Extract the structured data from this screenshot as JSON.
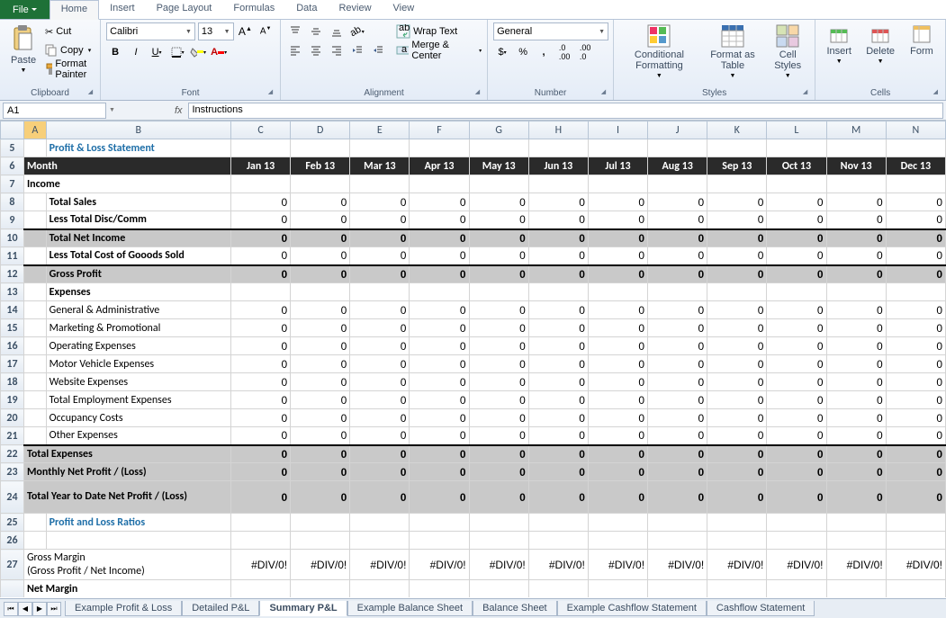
{
  "tabs": {
    "file": "File",
    "list": [
      "Home",
      "Insert",
      "Page Layout",
      "Formulas",
      "Data",
      "Review",
      "View"
    ],
    "active": 0
  },
  "clipboard": {
    "paste": "Paste",
    "cut": "Cut",
    "copy": "Copy",
    "fp": "Format Painter",
    "label": "Clipboard"
  },
  "font": {
    "name": "Calibri",
    "size": "13",
    "label": "Font"
  },
  "alignment": {
    "wrap": "Wrap Text",
    "merge": "Merge & Center",
    "label": "Alignment"
  },
  "number": {
    "format": "General",
    "label": "Number"
  },
  "styles": {
    "cf": "Conditional Formatting",
    "fat": "Format as Table",
    "cs": "Cell Styles",
    "label": "Styles"
  },
  "cells": {
    "ins": "Insert",
    "del": "Delete",
    "fmt": "Form",
    "label": "Cells"
  },
  "fbar": {
    "name": "A1",
    "value": "Instructions"
  },
  "cols": [
    "A",
    "B",
    "C",
    "D",
    "E",
    "F",
    "G",
    "H",
    "I",
    "J",
    "K",
    "L",
    "M",
    "N"
  ],
  "rows": [
    5,
    6,
    7,
    8,
    9,
    10,
    11,
    12,
    13,
    14,
    15,
    16,
    17,
    18,
    19,
    20,
    21,
    22,
    23,
    24,
    25,
    26,
    27
  ],
  "months": [
    "Jan 13",
    "Feb 13",
    "Mar 13",
    "Apr 13",
    "May 13",
    "Jun 13",
    "Jul 13",
    "Aug 13",
    "Sep 13",
    "Oct 13",
    "Nov 13",
    "Dec 13"
  ],
  "labels": {
    "title": "Profit & Loss Statement",
    "month": "Month",
    "income": "Income",
    "totSales": "Total Sales",
    "lessDisc": "Less Total Disc/Comm",
    "totNet": "Total Net Income",
    "lessCogs": "Less Total Cost of Gooods Sold",
    "gross": "Gross Profit",
    "expenses": "Expenses",
    "ga": "General & Administrative",
    "mp": "Marketing & Promotional",
    "oe": "Operating Expenses",
    "mv": "Motor Vehicle Expenses",
    "we": "Website Expenses",
    "te": "Total Employment Expenses",
    "oc": "Occupancy Costs",
    "ox": "Other Expenses",
    "totExp": "Total Expenses",
    "mnp": "Monthly Net Profit / (Loss)",
    "ytd": "Total Year to Date Net Profit / (Loss)",
    "ratios": "Profit and Loss Ratios",
    "gm1": "Gross Margin",
    "gm2": "(Gross Profit / Net Income)",
    "nm": "Net Margin"
  },
  "zeroRows": [
    "totSales",
    "lessDisc",
    "totNet",
    "lessCogs",
    "gross",
    "ga",
    "mp",
    "oe",
    "mv",
    "we",
    "te",
    "oc",
    "ox",
    "totExp",
    "mnp",
    "ytd"
  ],
  "div0": "#DIV/0!",
  "sheets": [
    "Example Profit & Loss",
    "Detailed P&L",
    "Summary P&L",
    "Example Balance Sheet",
    "Balance Sheet",
    "Example Cashflow Statement",
    "Cashflow Statement"
  ],
  "activeSheet": 2
}
